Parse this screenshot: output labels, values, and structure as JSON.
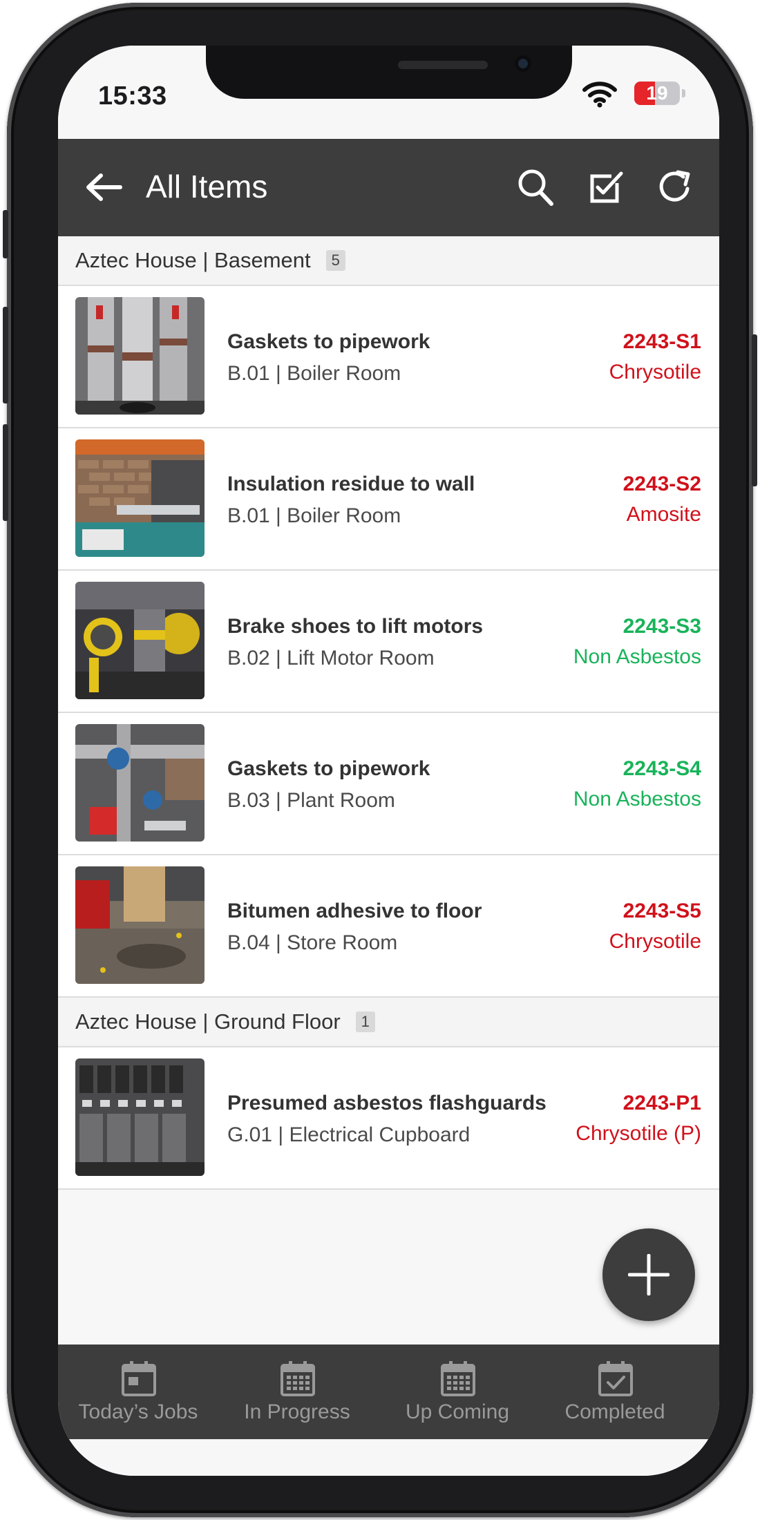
{
  "status_bar": {
    "time": "15:33",
    "battery": "19",
    "battery_level": 0.45
  },
  "header": {
    "title": "All Items"
  },
  "colors": {
    "app_bar": "#3d3d3d",
    "asbestos": "#d0111b",
    "non_asbestos": "#19b35a"
  },
  "groups": [
    {
      "title": "Aztec House | Basement",
      "count": "5",
      "items": [
        {
          "name": "Gaskets to pipework",
          "location": "B.01 | Boiler Room",
          "code": "2243-S1",
          "type": "Chrysotile",
          "status": "asbestos"
        },
        {
          "name": "Insulation residue to wall",
          "location": "B.01 | Boiler Room",
          "code": "2243-S2",
          "type": "Amosite",
          "status": "asbestos"
        },
        {
          "name": "Brake shoes to lift motors",
          "location": "B.02 | Lift Motor Room",
          "code": "2243-S3",
          "type": "Non Asbestos",
          "status": "non-asbestos"
        },
        {
          "name": "Gaskets to pipework",
          "location": "B.03 | Plant Room",
          "code": "2243-S4",
          "type": "Non Asbestos",
          "status": "non-asbestos"
        },
        {
          "name": "Bitumen adhesive to floor",
          "location": "B.04 | Store Room",
          "code": "2243-S5",
          "type": "Chrysotile",
          "status": "asbestos"
        }
      ]
    },
    {
      "title": "Aztec House | Ground Floor",
      "count": "1",
      "items": [
        {
          "name": "Presumed asbestos flashguards",
          "location": "G.01 | Electrical Cupboard",
          "code": "2243-P1",
          "type": "Chrysotile (P)",
          "status": "asbestos"
        }
      ]
    }
  ],
  "bottom_nav": [
    {
      "label": "Today’s Jobs",
      "icon": "calendar-today-icon"
    },
    {
      "label": "In Progress",
      "icon": "calendar-grid-icon"
    },
    {
      "label": "Up Coming",
      "icon": "calendar-grid-icon"
    },
    {
      "label": "Completed",
      "icon": "calendar-check-icon"
    }
  ]
}
